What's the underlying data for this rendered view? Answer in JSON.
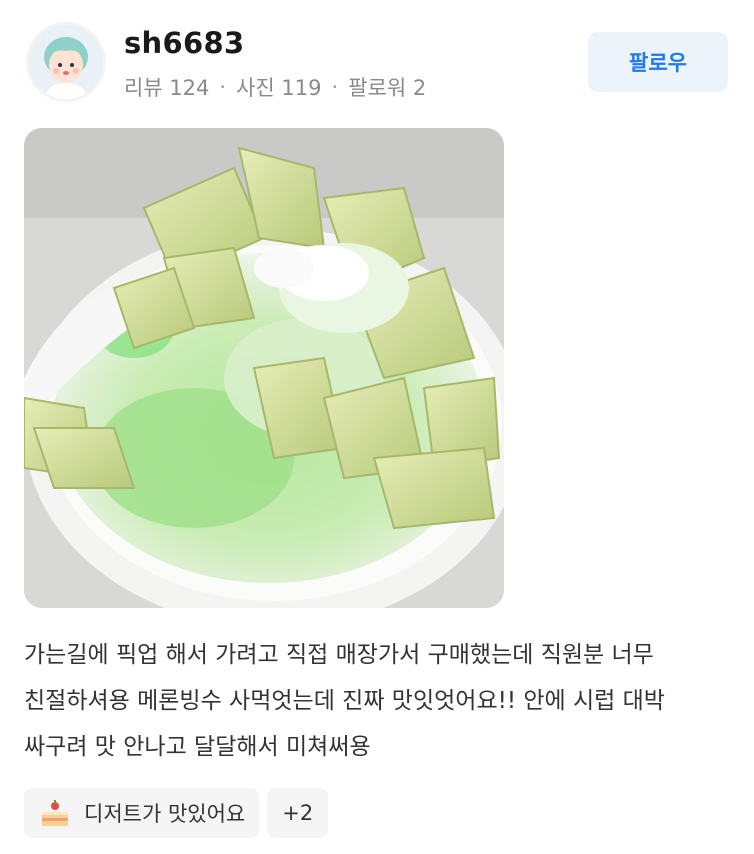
{
  "user": {
    "name": "sh6683",
    "stats": [
      "리뷰 124",
      "사진 119",
      "팔로워 2"
    ],
    "separator": "·"
  },
  "follow_button": {
    "label": "팔로우"
  },
  "review": {
    "text": "가는길에 픽업 해서 가려고 직접 매장가서 구매했는데 직원분 너무 친절하셔용 메론빙수 사먹엇는데 진짜 맛잇엇어요!! 안에 시럽 대박 싸구려 맛 안나고 달달해서 미쳐써용"
  },
  "tags": {
    "primary": {
      "icon": "cake-icon",
      "label": "디저트가 맛있어요"
    },
    "more": {
      "label": "+2"
    }
  },
  "colors": {
    "accent": "#1f78f0",
    "follow_bg": "#edf3fb",
    "tag_bg": "#f5f5f5",
    "stats_text": "#8a8a8a"
  }
}
